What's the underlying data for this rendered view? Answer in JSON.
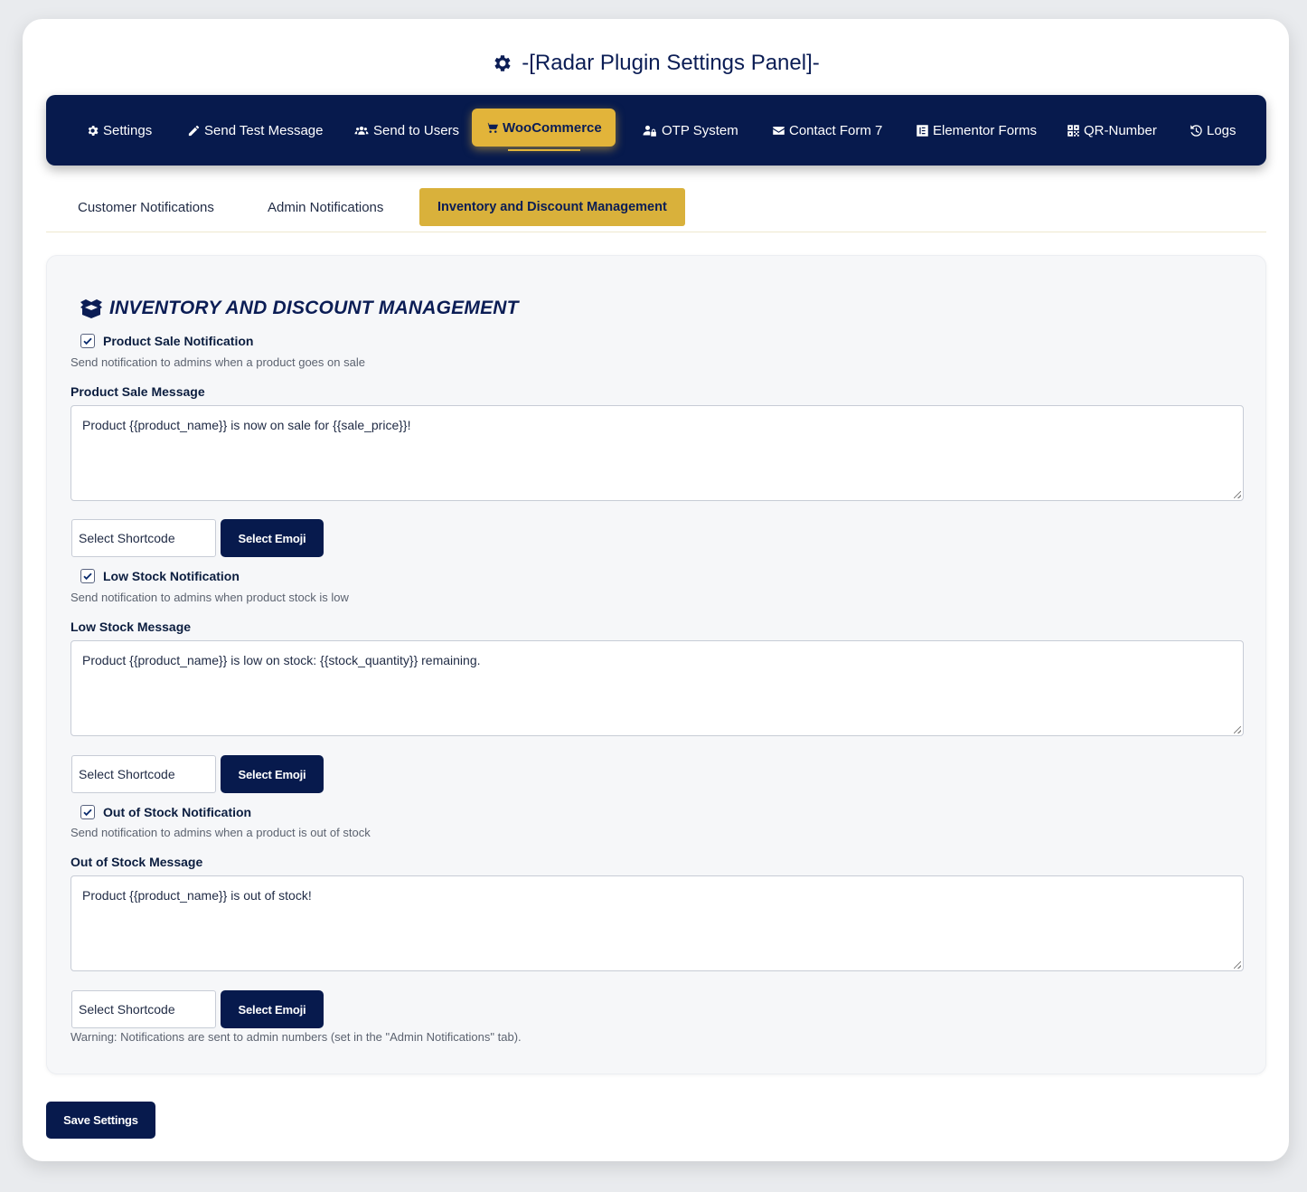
{
  "page": {
    "title": "-[Radar Plugin Settings Panel]-"
  },
  "nav": {
    "items": [
      {
        "label": "Settings",
        "icon": "gear-icon"
      },
      {
        "label": "Send Test Message",
        "icon": "pencil-icon"
      },
      {
        "label": "Send to Users",
        "icon": "users-icon"
      },
      {
        "label": "WooCommerce",
        "icon": "cart-icon",
        "active": true
      },
      {
        "label": "OTP System",
        "icon": "user-lock-icon"
      },
      {
        "label": "Contact Form 7",
        "icon": "envelope-icon"
      },
      {
        "label": "Elementor Forms",
        "icon": "elementor-icon"
      },
      {
        "label": "QR-Number",
        "icon": "qrcode-icon"
      },
      {
        "label": "Logs",
        "icon": "history-icon"
      }
    ]
  },
  "subtabs": [
    {
      "label": "Customer Notifications"
    },
    {
      "label": "Admin Notifications"
    },
    {
      "label": "Inventory and Discount Management",
      "active": true
    }
  ],
  "section": {
    "title": "Inventory and Discount Management",
    "icon": "box-open-icon"
  },
  "notifications": [
    {
      "checkbox_label": "Product Sale Notification",
      "checked": true,
      "description": "Send notification to admins when a product goes on sale",
      "message_label": "Product Sale Message",
      "message_value": "Product {{product_name}} is now on sale for {{sale_price}}!",
      "shortcode_placeholder": "Select Shortcode",
      "emoji_button": "Select Emoji"
    },
    {
      "checkbox_label": "Low Stock Notification",
      "checked": true,
      "description": "Send notification to admins when product stock is low",
      "message_label": "Low Stock Message",
      "message_value": "Product {{product_name}} is low on stock: {{stock_quantity}} remaining.",
      "shortcode_placeholder": "Select Shortcode",
      "emoji_button": "Select Emoji"
    },
    {
      "checkbox_label": "Out of Stock Notification",
      "checked": true,
      "description": "Send notification to admins when a product is out of stock",
      "message_label": "Out of Stock Message",
      "message_value": "Product {{product_name}} is out of stock!",
      "shortcode_placeholder": "Select Shortcode",
      "emoji_button": "Select Emoji"
    }
  ],
  "warning": "Warning: Notifications are sent to admin numbers (set in the \"Admin Notifications\" tab).",
  "save_button": "Save Settings",
  "colors": {
    "navy": "#071a4d",
    "gold": "#e2b43a",
    "panel": "#f6f7f9"
  }
}
